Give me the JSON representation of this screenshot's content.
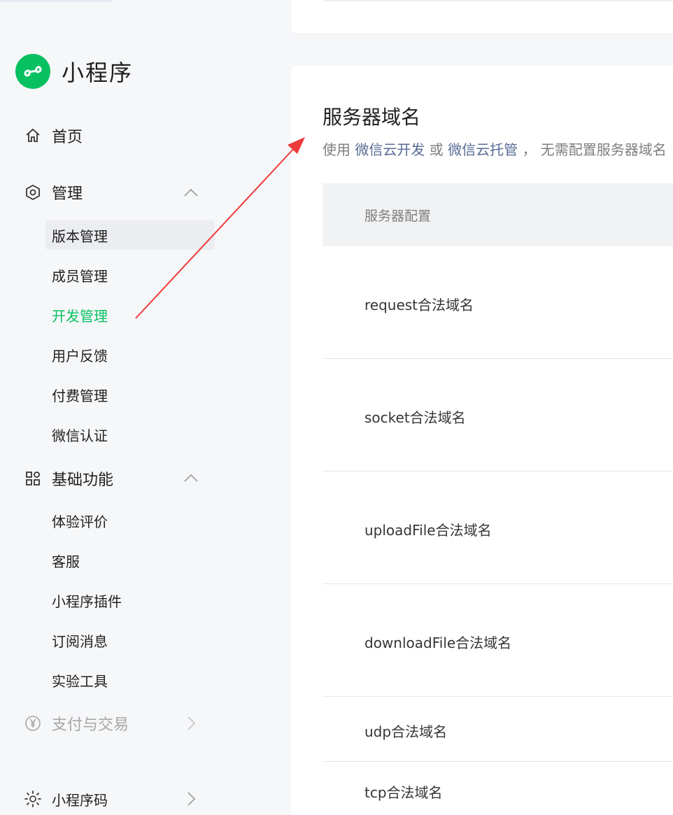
{
  "app": {
    "title": "小程序"
  },
  "sidebar": {
    "home": "首页",
    "manage": {
      "label": "管理",
      "items": [
        "版本管理",
        "成员管理",
        "开发管理",
        "用户反馈",
        "付费管理",
        "微信认证"
      ]
    },
    "basic": {
      "label": "基础功能",
      "items": [
        "体验评价",
        "客服",
        "小程序插件",
        "订阅消息",
        "实验工具"
      ]
    },
    "payment": "支付与交易",
    "qrcode": "小程序码"
  },
  "main": {
    "title": "服务器域名",
    "desc_prefix": "使用",
    "link1": "微信云开发",
    "desc_or": "或",
    "link2": "微信云托管",
    "desc_suffix": "， 无需配置服务器域名",
    "table_header": "服务器配置",
    "rows": [
      "request合法域名",
      "socket合法域名",
      "uploadFile合法域名",
      "downloadFile合法域名",
      "udp合法域名",
      "tcp合法域名"
    ]
  },
  "colors": {
    "brand": "#07c160",
    "link": "#576b95",
    "annotation": "#ee3b3b"
  }
}
